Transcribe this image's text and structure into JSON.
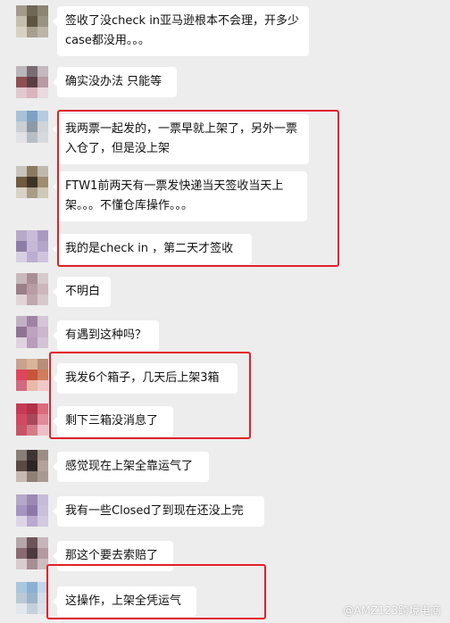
{
  "messages": [
    {
      "text": "签收了没check in亚马逊根本不会理，开多少case都没用。。。",
      "avatar": [
        "#a49a8a",
        "#6f6857",
        "#8c8574",
        "#c7bfae",
        "#5d5442",
        "#9a9283",
        "#d8d1c2",
        "#a79f8f",
        "#bcb5a6"
      ]
    },
    {
      "text": "确实没办法 只能等",
      "avatar": [
        "#b9b7bb",
        "#7a6c72",
        "#c4b8be",
        "#8e4f52",
        "#5a3f43",
        "#b79aa2",
        "#e2c9cf",
        "#d9b5bd",
        "#e9dadf"
      ]
    },
    {
      "text": "我两票一起发的，一票早就上架了，另外一票入仓了，但是没上架",
      "avatar": [
        "#a8c2d8",
        "#7fa1c1",
        "#b6cbe0",
        "#c9cfd4",
        "#8d9aa6",
        "#d0d4d9",
        "#e0e2e5",
        "#b8bec6",
        "#d6d9dd"
      ]
    },
    {
      "text": "FTW1前两天有一票发快递当天签收当天上架。。。不懂仓库操作。。。",
      "avatar": [
        "#c8c5bd",
        "#8a7a60",
        "#bfb9ad",
        "#6f5b3d",
        "#3d3428",
        "#9e8d70",
        "#d9d3c5",
        "#a99d86",
        "#cfc8b8"
      ]
    },
    {
      "text": "我的是check in ，第二天才签收",
      "avatar": [
        "#b7a9c9",
        "#c8bcd8",
        "#a99ac0",
        "#8d7ea8",
        "#c6b9d6",
        "#b3a6c9",
        "#d8cfe4",
        "#bcaed0",
        "#cfc4de"
      ]
    },
    {
      "text": "不明白",
      "avatar": [
        "#c9b9bd",
        "#a88f96",
        "#d7cacd",
        "#9c7f88",
        "#b89ca5",
        "#cdb7bd",
        "#e1d4d7",
        "#bfa8ae",
        "#d8c8cc"
      ]
    },
    {
      "text": "有遇到这种吗？",
      "avatar": [
        "#c4b0c6",
        "#9e84a2",
        "#d5c5d7",
        "#8f7393",
        "#bda3c0",
        "#cbb6cd",
        "#e0d2e1",
        "#b79db9",
        "#d4c3d6"
      ]
    },
    {
      "text": "我发6个箱子，几天后上架3箱",
      "avatar": [
        "#c9a38f",
        "#d8b59a",
        "#b88e79",
        "#e04560",
        "#c8553b",
        "#cf7d5e",
        "#d26a80",
        "#e8b9a8",
        "#f0c8c8"
      ]
    },
    {
      "text": "剩下三箱没消息了",
      "avatar": [
        "#c73a55",
        "#b13148",
        "#d96b7d",
        "#d24a62",
        "#a8485a",
        "#e08b98",
        "#c85468",
        "#d67b86",
        "#ecbfc6"
      ]
    },
    {
      "text": "感觉现在上架全靠运气了",
      "avatar": [
        "#8a7e78",
        "#3f3532",
        "#9c8e86",
        "#5a4a44",
        "#2d2624",
        "#b3a29a",
        "#c8bab2",
        "#8f7f77",
        "#a89a92"
      ]
    },
    {
      "text": "我有一些Closed了到现在还没上完",
      "avatar": [
        "#b6a8c8",
        "#9b8ab4",
        "#c7bcd7",
        "#a695c0",
        "#8c79a9",
        "#cbc0db",
        "#ddd5e7",
        "#b9aacf",
        "#d3c9e0"
      ]
    },
    {
      "text": "那这个要去索赔了",
      "avatar": [
        "#b7a7aa",
        "#6d5458",
        "#c6b6b9",
        "#8a6a70",
        "#4d3a3e",
        "#b39aa0",
        "#d9cbce",
        "#a88d93",
        "#cdbcc0"
      ]
    },
    {
      "text": "这操作，上架全凭运气",
      "avatar": [
        "#a9c6df",
        "#8bb1d2",
        "#c3d7e8",
        "#b9c9d6",
        "#9bb4c9",
        "#d4dfe8",
        "#e2e8ee",
        "#c4d0db",
        "#dbe3ea"
      ]
    }
  ],
  "watermark": "@AMZ123跨境电商"
}
